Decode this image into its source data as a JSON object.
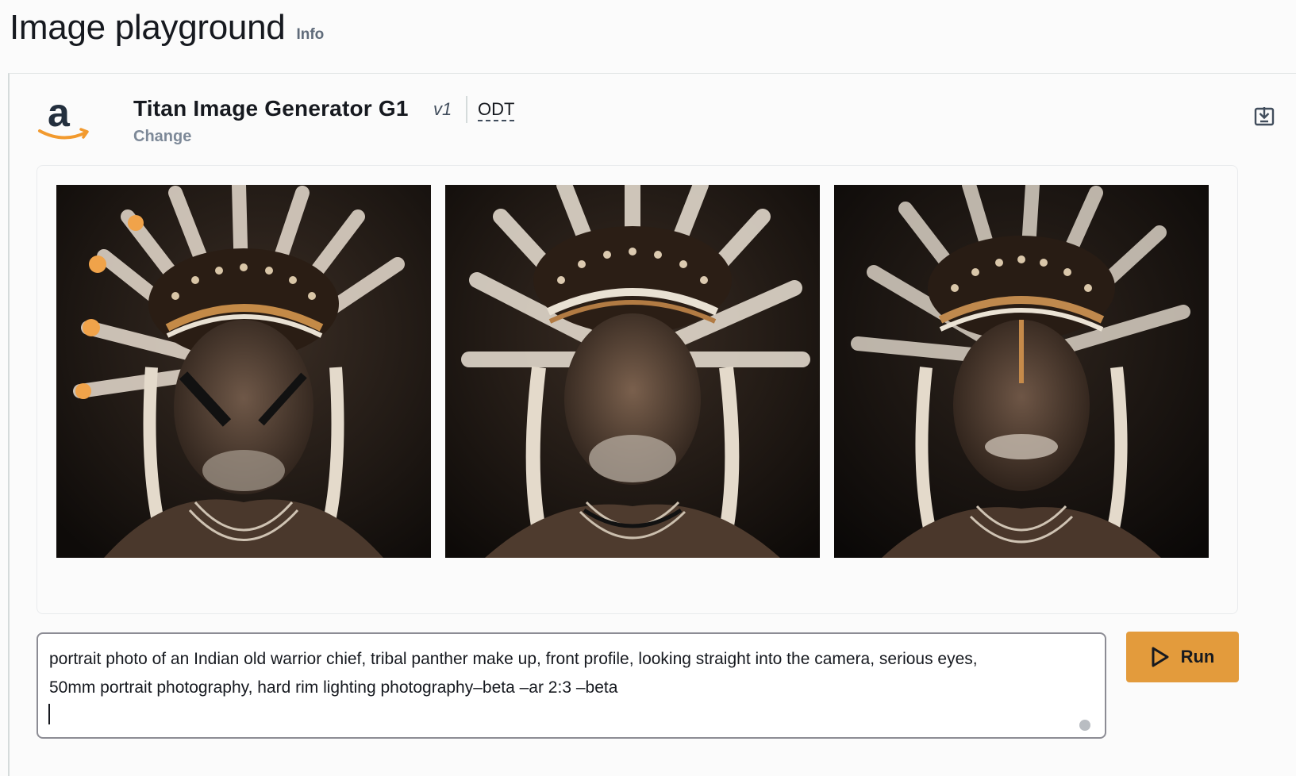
{
  "page": {
    "title": "Image playground",
    "info_label": "Info"
  },
  "model": {
    "name": "Titan Image Generator G1",
    "version": "v1",
    "throughput": "ODT",
    "change_label": "Change",
    "provider_logo": "amazon-logo",
    "download_icon": "download-icon"
  },
  "gallery": {
    "images": [
      {
        "alt": "Generated portrait image 1"
      },
      {
        "alt": "Generated portrait image 2"
      },
      {
        "alt": "Generated portrait image 3"
      }
    ]
  },
  "prompt": {
    "value": "portrait photo of an Indian old warrior chief, tribal panther make up, front profile, looking straight into the camera, serious eyes,\n50mm portrait photography, hard rim lighting photography–beta –ar 2:3 –beta"
  },
  "run_button": {
    "label": "Run",
    "icon": "play-icon",
    "color": "#e39b3c"
  },
  "colors": {
    "accent": "#e39b3c",
    "amazon_orange": "#f29a2e",
    "text": "#16191f",
    "muted": "#7d8998"
  }
}
